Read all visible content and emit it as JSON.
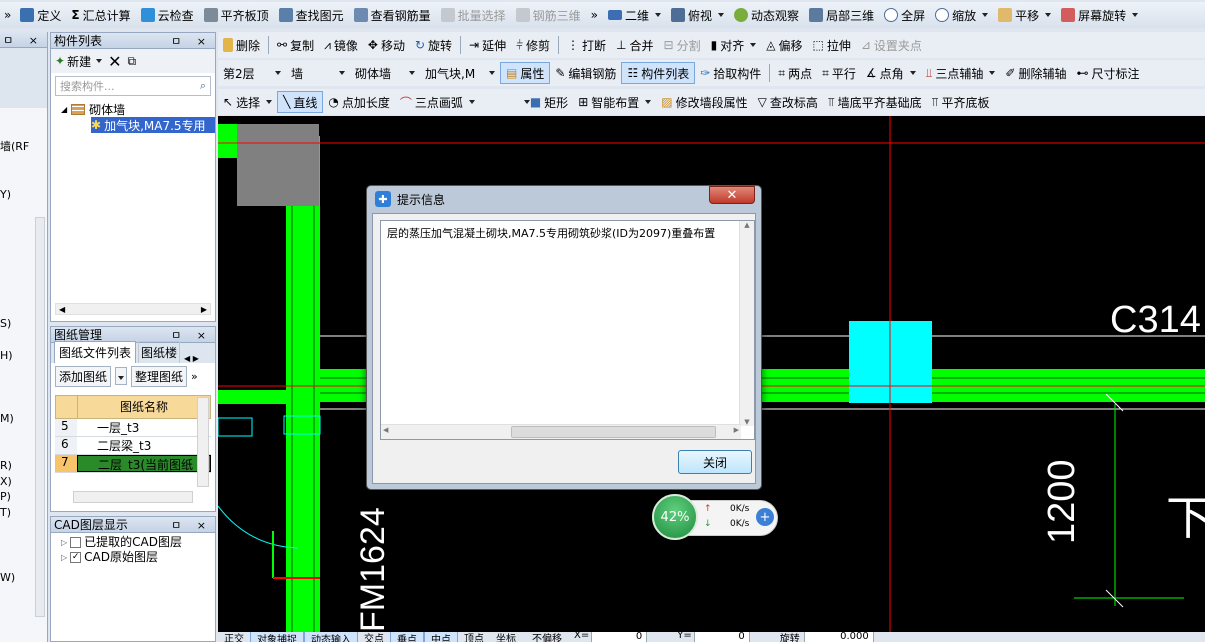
{
  "toolbar1": {
    "items": [
      "定义",
      "汇总计算",
      "云检查",
      "平齐板顶",
      "查找图元",
      "查看钢筋量",
      "批量选择",
      "钢筋三维",
      "二维",
      "俯视",
      "动态观察",
      "局部三维",
      "全屏",
      "缩放",
      "平移",
      "屏幕旋转"
    ]
  },
  "toolbar2": {
    "items": [
      "删除",
      "复制",
      "镜像",
      "移动",
      "旋转",
      "延伸",
      "修剪",
      "打断",
      "合并",
      "分割",
      "对齐",
      "偏移",
      "拉伸",
      "设置夹点"
    ]
  },
  "toolbar3": {
    "floor": "第2层",
    "type": "墙",
    "subtype": "砌体墙",
    "component": "加气块,M",
    "items": [
      "属性",
      "编辑钢筋",
      "构件列表",
      "拾取构件",
      "两点",
      "平行",
      "点角",
      "三点辅轴",
      "删除辅轴",
      "尺寸标注"
    ]
  },
  "toolbar4": {
    "items": [
      "选择",
      "直线",
      "点加长度",
      "三点画弧",
      "矩形",
      "智能布置",
      "修改墙段属性",
      "查改标高",
      "墙底平齐基础底",
      "平齐底板"
    ]
  },
  "component_panel": {
    "title": "构件列表",
    "new_label": "新建",
    "search_placeholder": "搜索构件...",
    "tree_root": "砌体墙",
    "tree_child": "加气块,MA7.5专用"
  },
  "left_strip": {
    "labels": [
      "墙(RF",
      "Y)",
      "S)",
      "H)",
      "M)",
      "R)",
      "X)",
      "P)",
      "T)",
      "W)"
    ]
  },
  "drawing_panel": {
    "title": "图纸管理",
    "tabs": [
      "图纸文件列表",
      "图纸楼"
    ],
    "add_label": "添加图纸",
    "organize_label": "整理图纸",
    "column_header": "图纸名称",
    "rows": [
      {
        "num": "5",
        "name": "一层_t3"
      },
      {
        "num": "6",
        "name": "二层梁_t3"
      },
      {
        "num": "7",
        "name": "二层_t3(当前图纸"
      }
    ]
  },
  "cad_panel": {
    "title": "CAD图层显示",
    "layers": [
      "已提取的CAD图层",
      "CAD原始图层"
    ]
  },
  "canvas": {
    "label_c314": "C314",
    "label_1200": "1200",
    "label_fm": "FM1624",
    "label_xia": "下"
  },
  "dialog": {
    "title": "提示信息",
    "message": "层的蒸压加气混凝土砌块,MA7.5专用砌筑砂浆(ID为2097)重叠布置",
    "close_button": "关闭"
  },
  "net_widget": {
    "percent": "42%",
    "up": "0K/s",
    "down": "0K/s"
  },
  "statusbar": {
    "items": [
      "正交",
      "对象捕捉",
      "动态输入",
      "交点",
      "垂点",
      "中点",
      "顶点",
      "坐标",
      "不偏移",
      "X=",
      "0",
      "Y=",
      "0",
      "旋转",
      "0.000"
    ]
  },
  "colors": {
    "canvas_bg": "#000000",
    "wall_green": "#00ff00",
    "column_cyan": "#00ffff",
    "axis_red": "#ff0000",
    "grey_block": "#808080"
  }
}
